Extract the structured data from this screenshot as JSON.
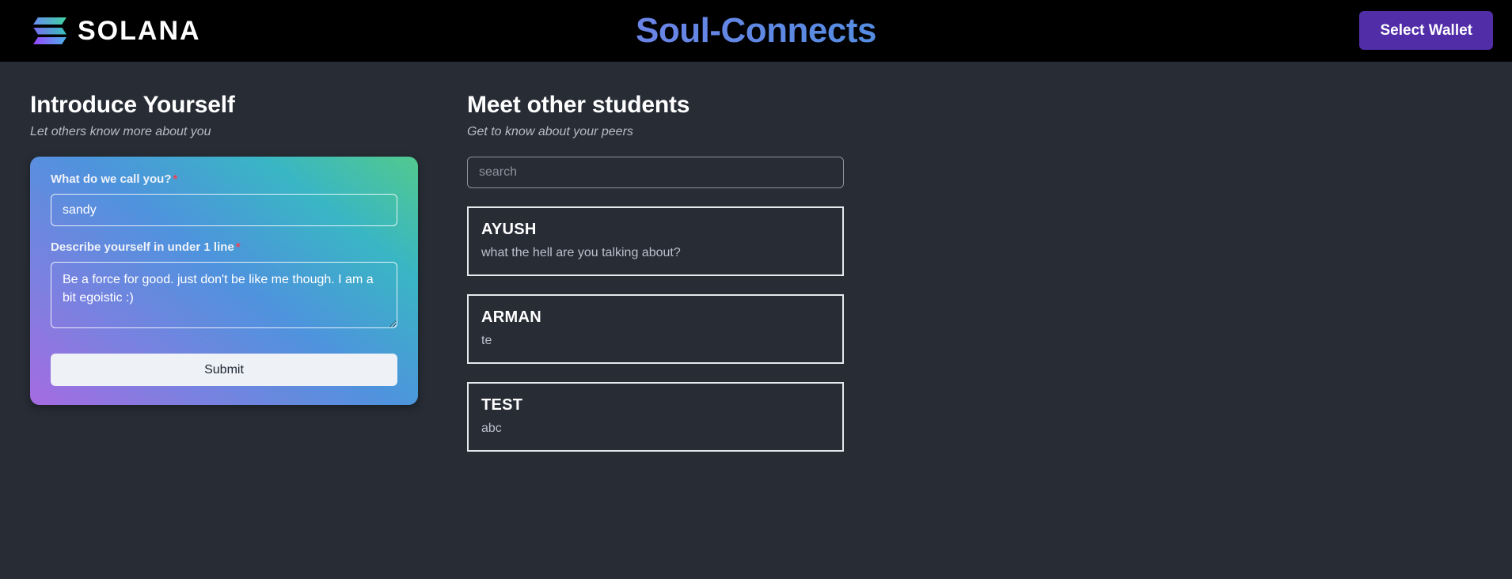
{
  "navbar": {
    "brand_name": "SOLANA",
    "brand_icon": "solana-logo-icon",
    "app_title": "Soul-Connects",
    "wallet_button": "Select Wallet",
    "colors": {
      "bar_background": "#000000",
      "wallet_button": "#512da8",
      "title_gradient_start": "#a07de0",
      "title_gradient_end": "#39b7cf"
    }
  },
  "introduce": {
    "title": "Introduce Yourself",
    "subtitle": "Let others know more about you",
    "name_field": {
      "label": "What do we call you?",
      "required_mark": "*",
      "value": "sandy",
      "placeholder": ""
    },
    "describe_field": {
      "label": "Describe yourself in under 1 line",
      "required_mark": "*",
      "value": "Be a force for good. just don't be like me though. I am a bit egoistic :)",
      "placeholder": ""
    },
    "submit_label": "Submit",
    "card_gradient": [
      "#a56be0",
      "#4e93dd",
      "#52c98e"
    ]
  },
  "meet": {
    "title": "Meet other students",
    "subtitle": "Get to know about your peers",
    "search": {
      "placeholder": "search",
      "value": ""
    },
    "students": [
      {
        "name": "AYUSH",
        "description": "what the hell are you talking about?"
      },
      {
        "name": "ARMAN",
        "description": "te"
      },
      {
        "name": "TEST",
        "description": "abc"
      }
    ]
  },
  "theme": {
    "page_background": "#272c35",
    "text_primary": "#ffffff",
    "text_muted": "#b7bdc6",
    "required_color": "#ef4056"
  }
}
